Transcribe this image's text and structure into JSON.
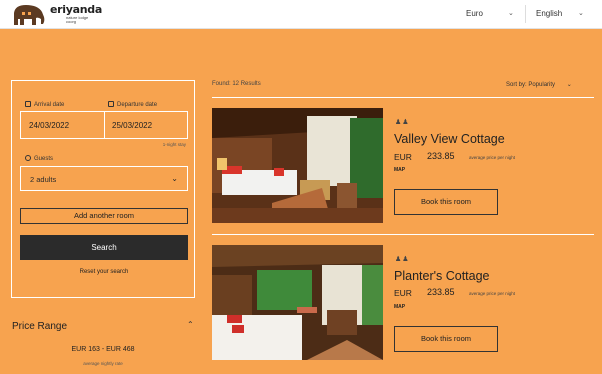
{
  "brand": {
    "name": "eriyanda",
    "tagline": "nature lodge coorg"
  },
  "header": {
    "currency": "Euro",
    "language": "English"
  },
  "search": {
    "arrival_label": "Arrival date",
    "arrival_value": "24/03/2022",
    "departure_label": "Departure date",
    "departure_value": "25/03/2022",
    "night_stay": "1-night stay",
    "guests_label": "Guests",
    "guests_value": "2 adults",
    "add_room": "Add another room",
    "search_button": "Search",
    "reset": "Reset your search"
  },
  "price_range": {
    "title": "Price Range",
    "value": "EUR 163 - EUR 468",
    "sub": "average nightly rate"
  },
  "results": {
    "found": "Found: 12 Results",
    "sort": "Sort by: Popularity"
  },
  "rooms": [
    {
      "name": "Valley View Cottage",
      "currency": "EUR",
      "price": "233.85",
      "avg_label": "average price per night",
      "map": "MAP",
      "book": "Book this room"
    },
    {
      "name": "Planter's Cottage",
      "currency": "EUR",
      "price": "233.85",
      "avg_label": "average price per night",
      "map": "MAP",
      "book": "Book this room"
    }
  ],
  "icons": {
    "calendar": "calendar-icon",
    "person": "person-icon",
    "chevron": "chevron-down-icon",
    "people": "people-icon"
  },
  "colors": {
    "background": "#f7a34f",
    "button": "#2b2b2b",
    "header": "#ffffff"
  }
}
